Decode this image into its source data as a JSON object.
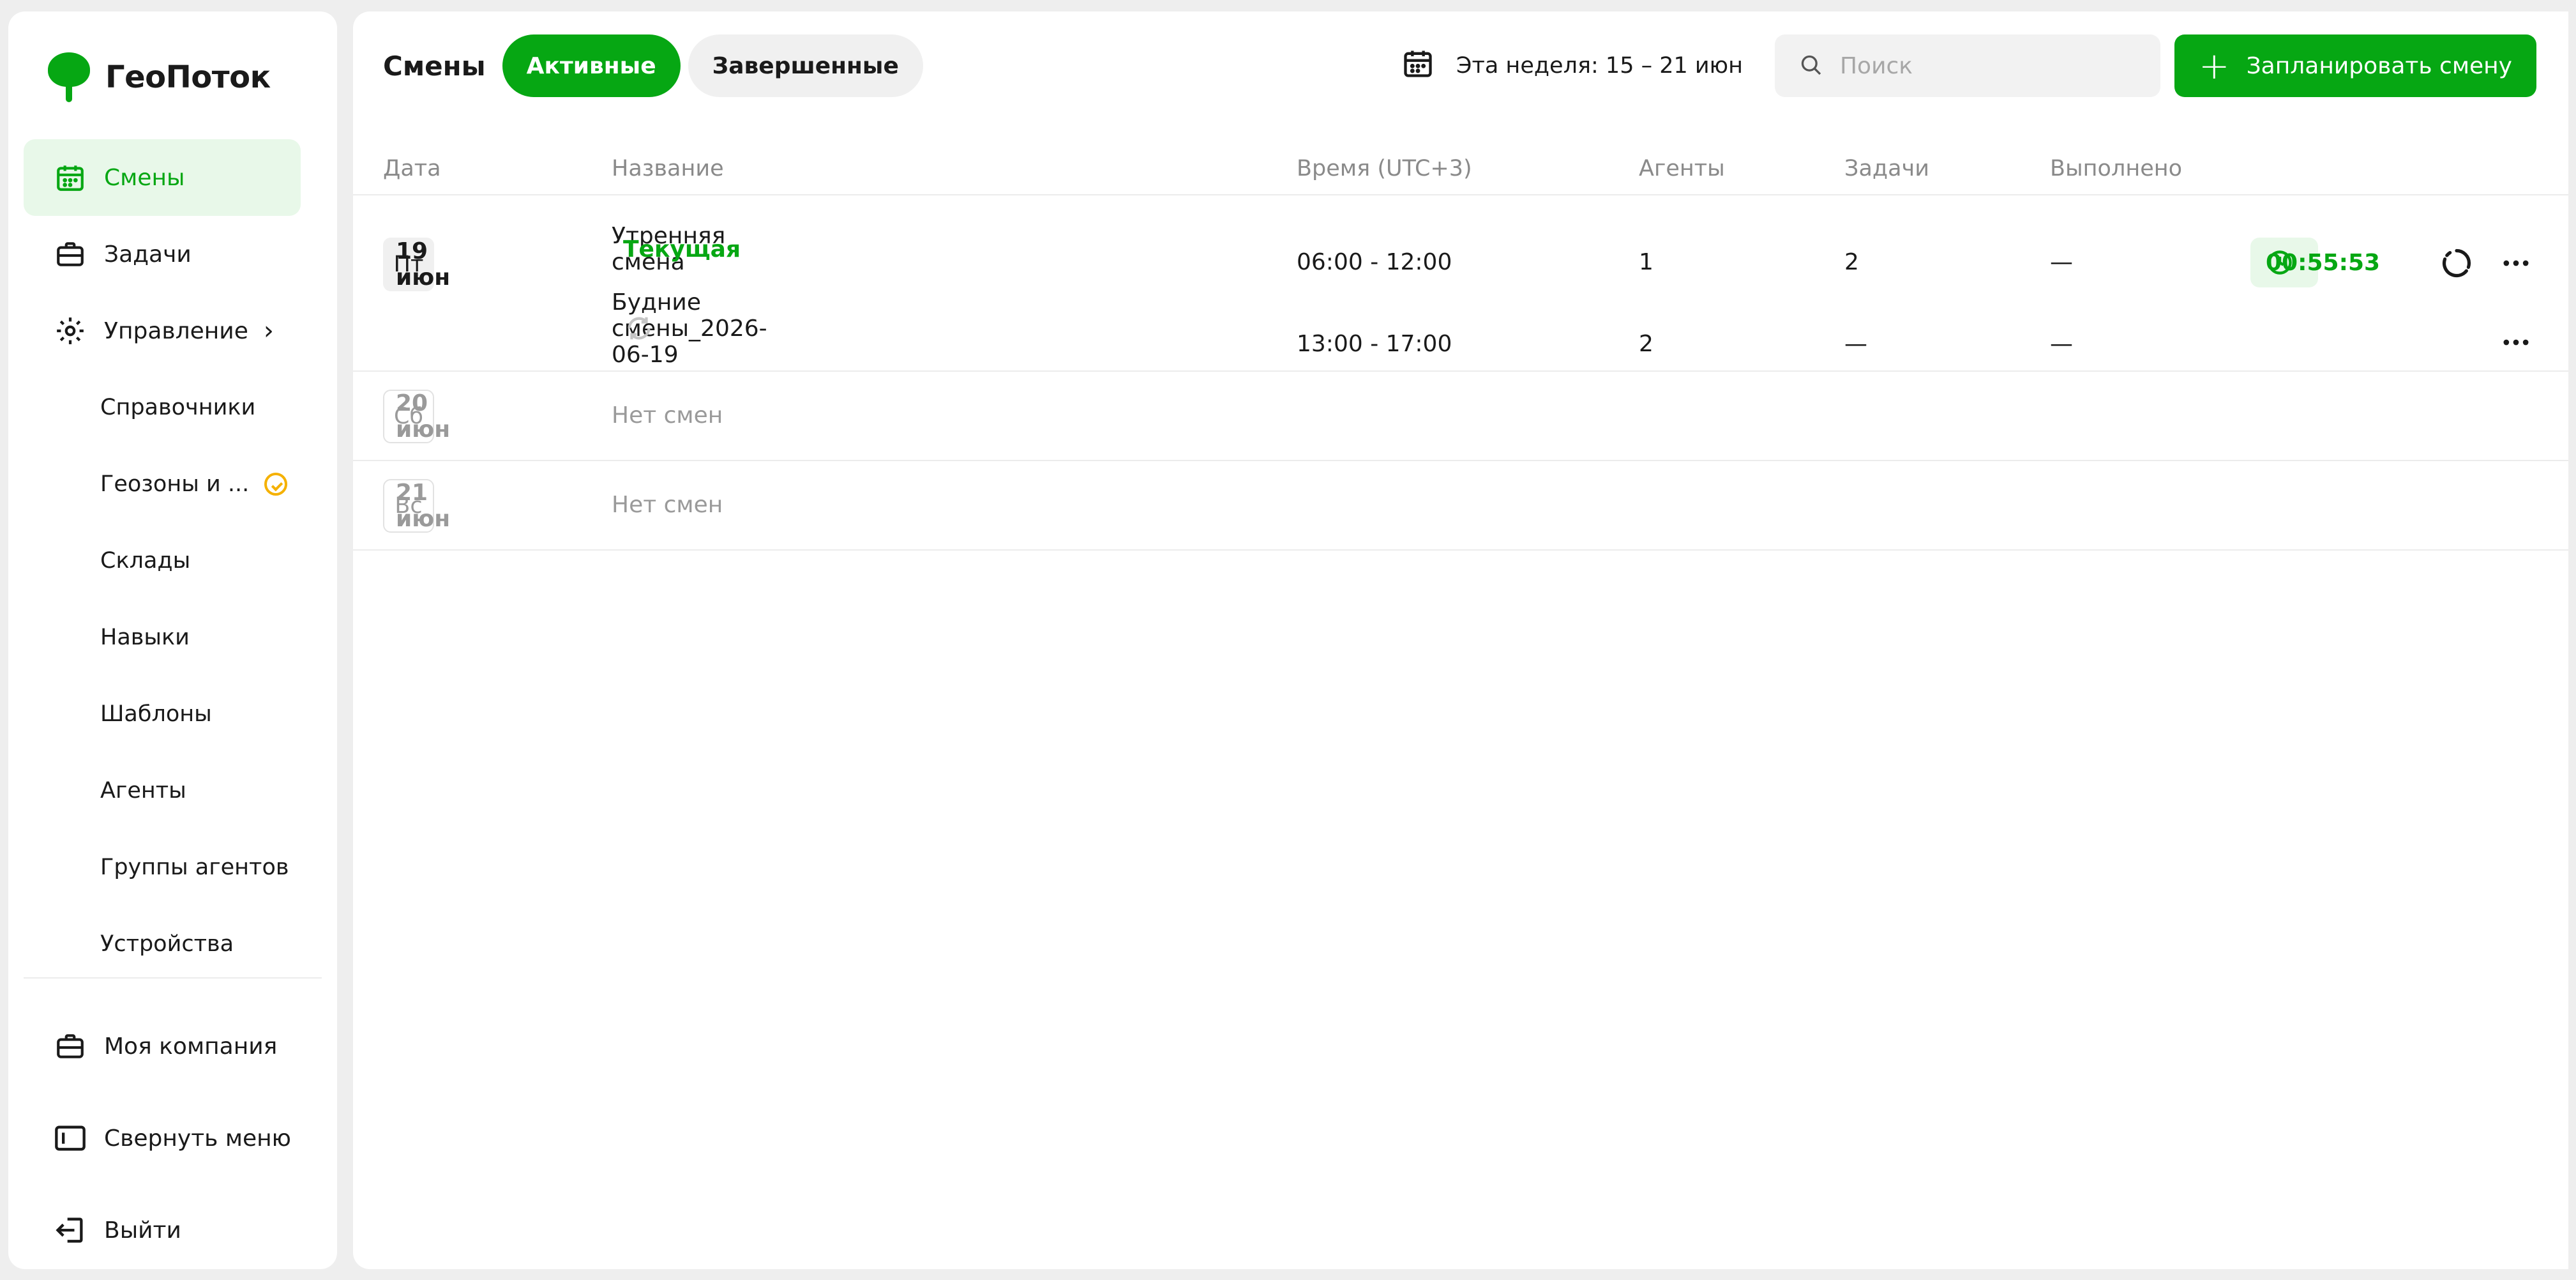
{
  "app": {
    "name": "ГеоПоток"
  },
  "colors": {
    "accent": "#06a713",
    "accent_light": "#e8f8e9",
    "warning": "#f5b100"
  },
  "sidebar": {
    "items": [
      {
        "label": "Смены",
        "icon": "calendar-icon",
        "active": true
      },
      {
        "label": "Задачи",
        "icon": "briefcase-icon",
        "active": false
      },
      {
        "label": "Управление",
        "icon": "gear-icon",
        "active": false,
        "expandable": true
      }
    ],
    "submenu": [
      {
        "label": "Справочники"
      },
      {
        "label": "Геозоны и ...",
        "badge": "clock-check-icon"
      },
      {
        "label": "Склады"
      },
      {
        "label": "Навыки"
      },
      {
        "label": "Шаблоны"
      },
      {
        "label": "Агенты"
      },
      {
        "label": "Группы агентов"
      },
      {
        "label": "Устройства"
      }
    ],
    "bottom": [
      {
        "label": "Моя компания",
        "icon": "briefcase-icon"
      },
      {
        "label": "Свернуть меню",
        "icon": "sidebar-collapse-icon"
      },
      {
        "label": "Выйти",
        "icon": "logout-icon"
      }
    ]
  },
  "header": {
    "title": "Смены",
    "tabs": [
      {
        "label": "Активные",
        "active": true
      },
      {
        "label": "Завершенные",
        "active": false
      }
    ],
    "week_label": "Эта неделя: 15 – 21 июн",
    "search_placeholder": "Поиск",
    "search_value": "",
    "create_button": "Запланировать смену"
  },
  "table": {
    "columns": [
      "Дата",
      "Название",
      "Время (UTC+3)",
      "Агенты",
      "Задачи",
      "Выполнено"
    ],
    "days": [
      {
        "weekday": "Пт",
        "date": "19 июн",
        "has_shifts": true,
        "shifts": [
          {
            "name": "Утренняя смена",
            "tag": "Текущая",
            "time": "06:00 - 12:00",
            "agents": "1",
            "tasks": "2",
            "done": "—",
            "timer": "00:55:53"
          },
          {
            "name": "Будние смены_2026-06-19",
            "recurring": true,
            "time": "13:00 - 17:00",
            "agents": "2",
            "tasks": "—",
            "done": "—"
          }
        ]
      },
      {
        "weekday": "Сб",
        "date": "20 июн",
        "has_shifts": false,
        "empty_label": "Нет смен"
      },
      {
        "weekday": "Вс",
        "date": "21 июн",
        "has_shifts": false,
        "empty_label": "Нет смен"
      }
    ]
  }
}
